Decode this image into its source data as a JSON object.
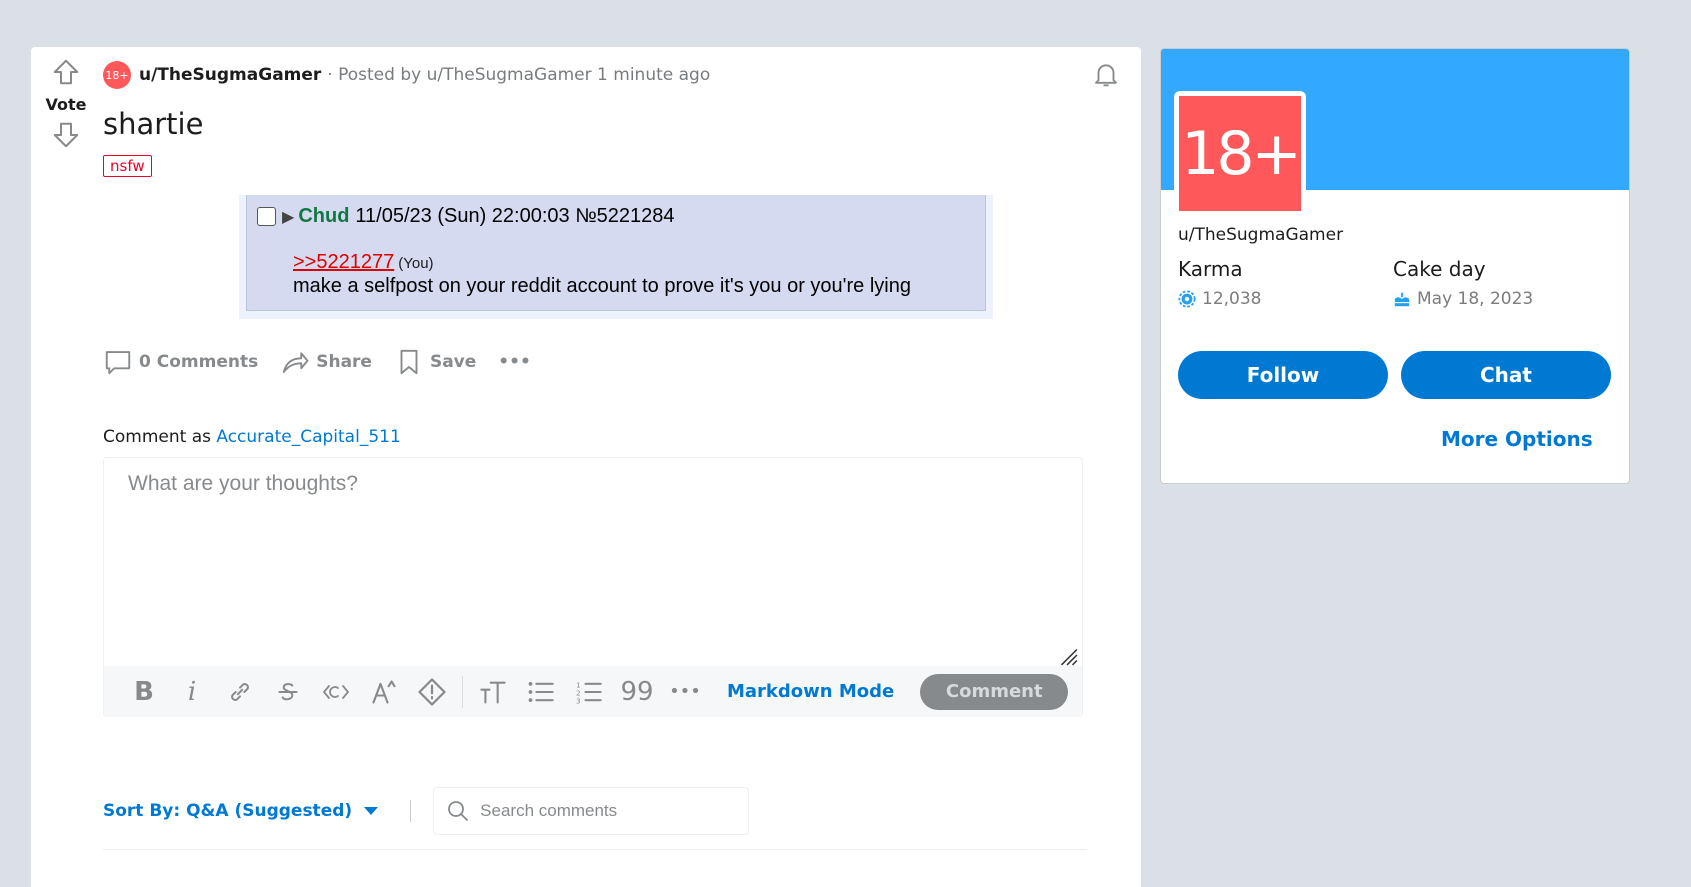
{
  "post": {
    "vote_label": "Vote",
    "avatar_badge": "18+",
    "author": "u/TheSugmaGamer",
    "meta": "· Posted by u/TheSugmaGamer 1 minute ago",
    "title": "shartie",
    "flair": "nsfw",
    "image": {
      "name": "Chud",
      "date": "11/05/23 (Sun) 22:00:03 №5221284",
      "quote_link": ">>5221277",
      "you": "(You)",
      "message": "make a selfpost on your reddit account to prove it's you or you're lying"
    }
  },
  "actions": {
    "comments": "0 Comments",
    "share": "Share",
    "save": "Save",
    "more": "•••"
  },
  "comment": {
    "as_prefix": "Comment as",
    "username": "Accurate_Capital_511",
    "placeholder": "What are your thoughts?",
    "markdown_mode": "Markdown Mode",
    "submit": "Comment",
    "toolbar": {
      "bold": "B",
      "italic": "i",
      "superscript": "A^",
      "heading": "TT",
      "quote": "99",
      "more": "•••"
    }
  },
  "sort": {
    "label": "Sort By: Q&A (Suggested)",
    "search_placeholder": "Search comments"
  },
  "profile": {
    "avatar_text": "18+",
    "username": "u/TheSugmaGamer",
    "karma_label": "Karma",
    "karma_value": "12,038",
    "cakeday_label": "Cake day",
    "cakeday_value": "May 18, 2023",
    "follow": "Follow",
    "chat": "Chat",
    "more_options": "More Options"
  },
  "colors": {
    "page_bg": "#dae0e6",
    "accent": "#0079d3",
    "banner": "#33a8ff",
    "nsfw": "#ff585b"
  }
}
